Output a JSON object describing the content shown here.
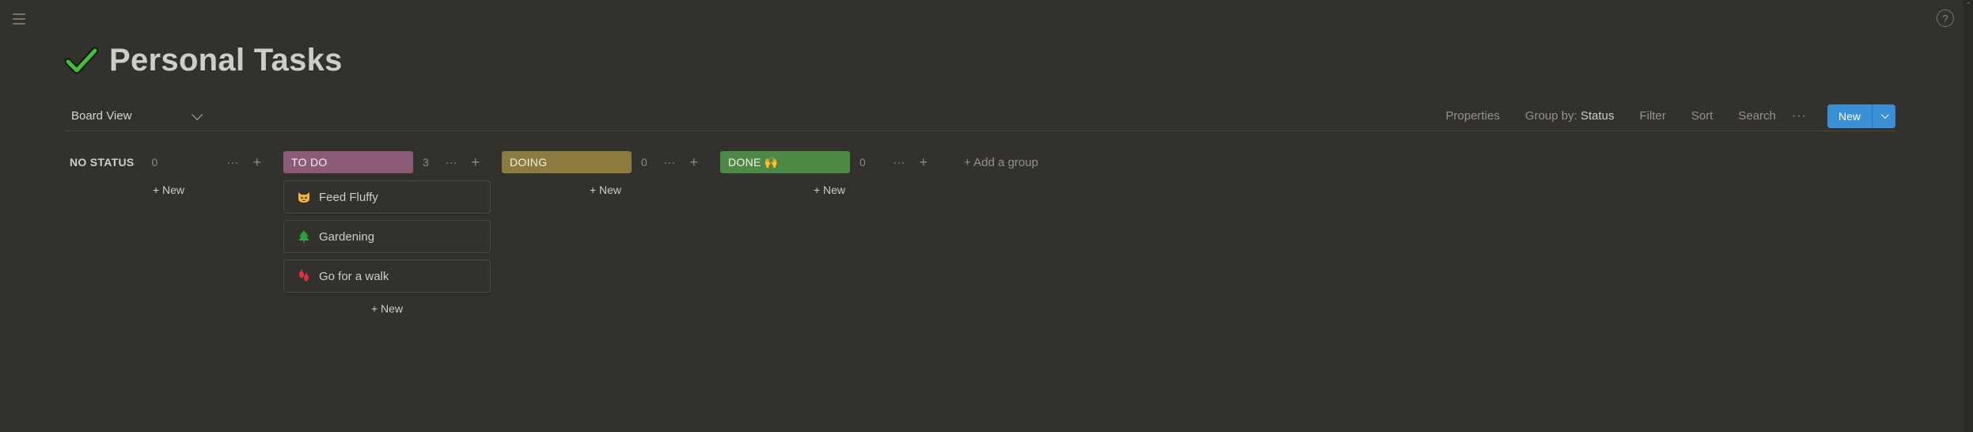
{
  "page": {
    "title": "Personal Tasks",
    "title_icon": "check-icon"
  },
  "toolbar": {
    "view_label": "Board View",
    "properties": "Properties",
    "group_by_label": "Group by:",
    "group_by_value": "Status",
    "filter": "Filter",
    "sort": "Sort",
    "search": "Search",
    "more": "···",
    "new_label": "New"
  },
  "help": {
    "label": "?"
  },
  "columns": [
    {
      "label": "NO STATUS",
      "count": "0",
      "new_label": "+ New",
      "color": ""
    },
    {
      "label": "TO DO",
      "count": "3",
      "new_label": "+ New",
      "color": "#8b5b78"
    },
    {
      "label": "DOING",
      "count": "0",
      "new_label": "+ New",
      "color": "#8c7b3f"
    },
    {
      "label": "DONE 🙌",
      "count": "0",
      "new_label": "+ New",
      "color": "#4e8a45"
    }
  ],
  "column_actions": {
    "more": "···",
    "add": "+"
  },
  "cards": [
    {
      "title": "Feed Fluffy",
      "icon": "cat-face-icon"
    },
    {
      "title": "Gardening",
      "icon": "tree-icon"
    },
    {
      "title": "Go for a walk",
      "icon": "footprints-icon"
    }
  ],
  "add_group": "+ Add a group"
}
